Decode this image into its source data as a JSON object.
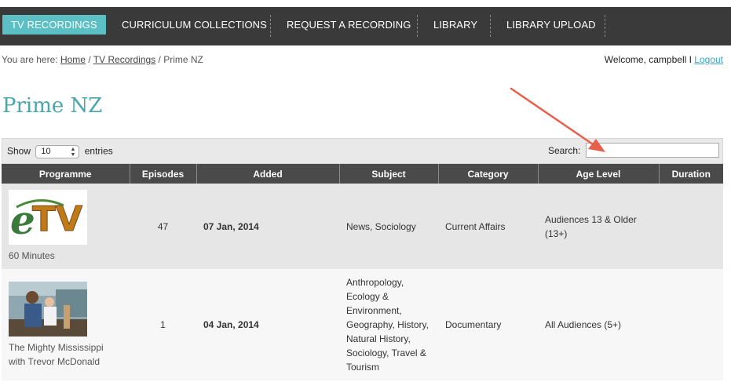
{
  "nav": {
    "items": [
      {
        "label": "TV RECORDINGS",
        "active": true
      },
      {
        "label": "CURRICULUM COLLECTIONS",
        "active": false
      },
      {
        "label": "REQUEST A RECORDING",
        "active": false
      },
      {
        "label": "LIBRARY",
        "active": false
      },
      {
        "label": "LIBRARY UPLOAD",
        "active": false
      }
    ]
  },
  "breadcrumb": {
    "prefix": "You are here:",
    "home": "Home",
    "sep": "/",
    "tv": "TV Recordings",
    "current": "Prime NZ"
  },
  "welcome": {
    "text": "Welcome, campbell I",
    "logout": "Logout"
  },
  "page": {
    "title": "Prime NZ"
  },
  "controls": {
    "show": "Show",
    "entries_value": "10",
    "entries": "entries",
    "search_label": "Search:",
    "search_value": ""
  },
  "table": {
    "headers": [
      "Programme",
      "Episodes",
      "Added",
      "Subject",
      "Category",
      "Age Level",
      "Duration"
    ],
    "rows": [
      {
        "thumb_icon": "etv-logo-thumbnail",
        "programme": "60 Minutes",
        "episodes": "47",
        "added": "07 Jan, 2014",
        "subject": "News, Sociology",
        "category": "Current Affairs",
        "age_level": "Audiences 13 & Older (13+)",
        "duration": ""
      },
      {
        "thumb_icon": "photo-thumbnail",
        "programme": "The Mighty Mississippi with Trevor McDonald",
        "episodes": "1",
        "added": "04 Jan, 2014",
        "subject": "Anthropology, Ecology & Environment, Geography, History, Natural History, Sociology, Travel & Tourism",
        "category": "Documentary",
        "age_level": "All Audiences (5+)",
        "duration": ""
      }
    ]
  },
  "colors": {
    "nav_bg": "#3a3a3a",
    "nav_active": "#5bbfc4",
    "title": "#4aa6ad",
    "header_bg": "#4a4a4a",
    "annotation_arrow": "#e8604c"
  }
}
